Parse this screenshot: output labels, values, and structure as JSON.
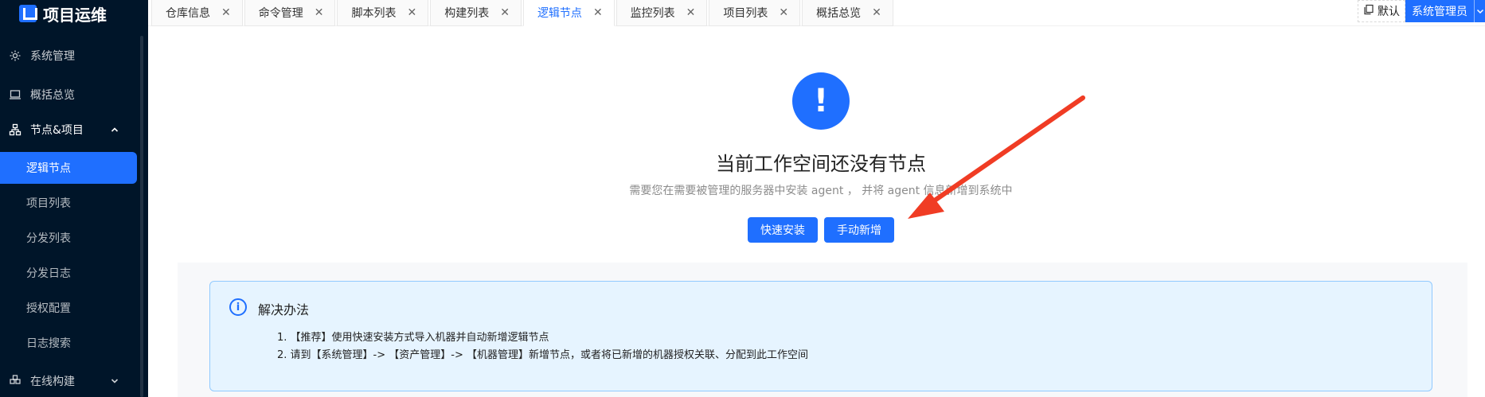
{
  "app": {
    "logo_text": "项目运维"
  },
  "sidebar": {
    "items": [
      {
        "label": "系统管理",
        "icon": "gear-icon"
      },
      {
        "label": "概括总览",
        "icon": "laptop-icon"
      },
      {
        "label": "节点&项目",
        "icon": "cluster-icon",
        "expanded": true
      },
      {
        "label": "在线构建",
        "icon": "build-icon",
        "expanded": false
      }
    ],
    "subitems": [
      {
        "label": "逻辑节点",
        "active": true
      },
      {
        "label": "项目列表"
      },
      {
        "label": "分发列表"
      },
      {
        "label": "分发日志"
      },
      {
        "label": "授权配置"
      },
      {
        "label": "日志搜索"
      }
    ]
  },
  "tabs": [
    {
      "label": "仓库信息"
    },
    {
      "label": "命令管理"
    },
    {
      "label": "脚本列表"
    },
    {
      "label": "构建列表"
    },
    {
      "label": "逻辑节点",
      "active": true
    },
    {
      "label": "监控列表"
    },
    {
      "label": "项目列表"
    },
    {
      "label": "概括总览"
    }
  ],
  "tab_close_glyph": "✕",
  "header": {
    "workspace": "默认",
    "user": "系统管理员"
  },
  "empty_state": {
    "icon_glyph": "!",
    "title": "当前工作空间还没有节点",
    "subtitle": "需要您在需要被管理的服务器中安装 agent ， 并将 agent 信息新增到系统中",
    "quick_install_label": "快速安装",
    "manual_add_label": "手动新增"
  },
  "alert": {
    "icon_glyph": "i",
    "title": "解决办法",
    "steps": [
      "1. 【推荐】使用快速安装方式导入机器并自动新增逻辑节点",
      "2. 请到【系统管理】-> 【资产管理】-> 【机器管理】新增节点，或者将已新增的机器授权关联、分配到此工作空间"
    ]
  },
  "colors": {
    "primary": "#1f6fff",
    "sidebar_bg": "#001529",
    "annotation_arrow": "#f03c24"
  }
}
